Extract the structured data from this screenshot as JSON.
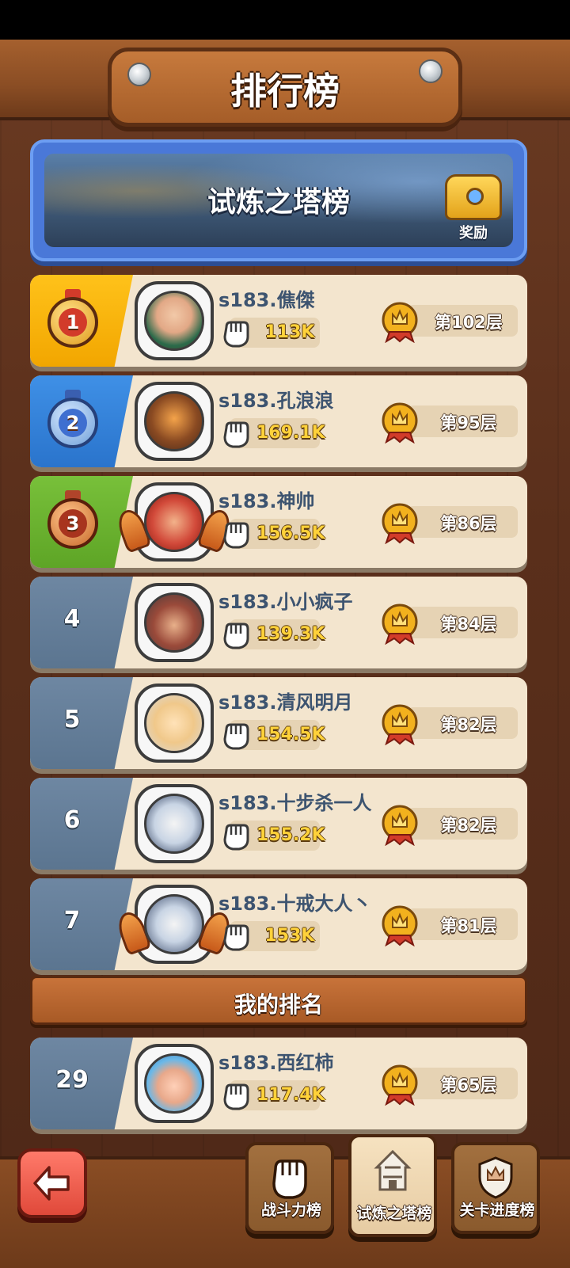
{
  "header": {
    "title": "排行榜"
  },
  "banner": {
    "title": "试炼之塔榜",
    "reward_label": "奖励"
  },
  "rankings": [
    {
      "rank": "1",
      "name": "s183.僬傑",
      "power": "113K",
      "floor": "第102层",
      "tier": "gold"
    },
    {
      "rank": "2",
      "name": "s183.孔浪浪",
      "power": "169.1K",
      "floor": "第95层",
      "tier": "blue"
    },
    {
      "rank": "3",
      "name": "s183.神帅",
      "power": "156.5K",
      "floor": "第86层",
      "tier": "bronze"
    },
    {
      "rank": "4",
      "name": "s183.小小疯子",
      "power": "139.3K",
      "floor": "第84层",
      "tier": "normal"
    },
    {
      "rank": "5",
      "name": "s183.清风明月",
      "power": "154.5K",
      "floor": "第82层",
      "tier": "normal"
    },
    {
      "rank": "6",
      "name": "s183.十步杀一人",
      "power": "155.2K",
      "floor": "第82层",
      "tier": "normal"
    },
    {
      "rank": "7",
      "name": "s183.十戒大人丶",
      "power": "153K",
      "floor": "第81层",
      "tier": "normal"
    }
  ],
  "my_rank": {
    "header": "我的排名",
    "rank": "29",
    "name": "s183.西红柿",
    "power": "117.4K",
    "floor": "第65层"
  },
  "nav": {
    "tabs": [
      {
        "label": "战斗力榜",
        "icon": "fist-icon",
        "active": false
      },
      {
        "label": "试炼之塔榜",
        "icon": "tower-icon",
        "active": true
      },
      {
        "label": "关卡进度榜",
        "icon": "shield-icon",
        "active": false
      }
    ]
  },
  "colors": {
    "gold": "#f2a600",
    "blue": "#2a74cc",
    "green": "#5ea526",
    "slate": "#5b7590",
    "card": "#f3e5ce",
    "name": "#3d5470",
    "power": "#ffd23a"
  }
}
